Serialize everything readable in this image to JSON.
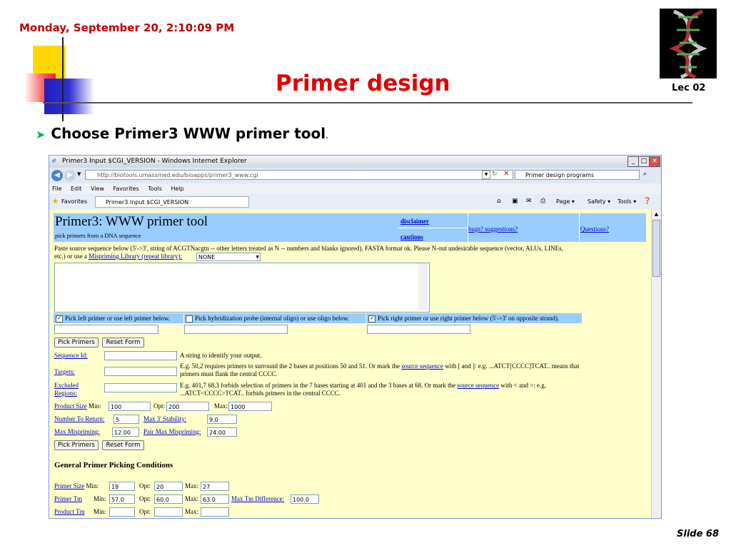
{
  "slide": {
    "datetime": "Monday, September 20, 2:10:09 PM",
    "title": "Primer design",
    "lecture": "Lec 02",
    "bullet": "Choose Primer3 WWW primer tool",
    "bullet_tail": ".",
    "slide_number": "Slide 68"
  },
  "browser": {
    "window_title": "Primer3 Input $CGI_VERSION - Windows Internet Explorer",
    "url": "http://biotools.umassmed.edu/bioapps/primer3_www.cgi",
    "search_value": "Primer design programs",
    "menu": [
      "File",
      "Edit",
      "View",
      "Favorites",
      "Tools",
      "Help"
    ],
    "favorites_label": "Favorites",
    "tab_label": "Primer3 Input $CGI_VERSION",
    "toolbar_right": [
      "Page ▾",
      "Safety ▾",
      "Tools ▾"
    ]
  },
  "page": {
    "heading": "Primer3: WWW primer tool",
    "subheading": "pick primers from a DNA sequence",
    "links": {
      "disclaimer": "disclaimer",
      "cautions": "cautions",
      "bugs": "bugs? suggestions?",
      "questions": "Questions?"
    },
    "intro_text_1": "Paste source sequence below (5'->3', string of ACGTNacgtn -- other letters treated as N -- numbers and blanks ignored). FASTA format ok. Please N-out undesirable sequence (vector, ALUs, LINEs,",
    "intro_text_2_prefix": "etc.) or use a",
    "mispriming_link": "Mispriming Library (repeat library):",
    "mispriming_value": "NONE",
    "pick_left": "Pick left primer or use left primer below.",
    "pick_probe": "Pick hybridization probe (internal oligo) or use oligo below.",
    "pick_right": "Pick right primer or use right primer below (5'->3' on opposite strand).",
    "pick_primers_button": "Pick Primers",
    "reset_form_button": "Reset Form",
    "sequence_id_label": "Sequence Id:",
    "sequence_id_help": "A string to identify your output.",
    "targets_label": "Targets:",
    "targets_help_1_prefix": "E.g. 50,2 requires primers to surround the 2 bases at positions 50 and 51. Or mark the",
    "source_sequence_link": "source sequence",
    "targets_help_1_suffix": "with [ and ]: e.g. ...ATCT[CCCC]TCAT.. means that",
    "targets_help_2": "primers must flank the central CCCC.",
    "excluded_label_1": "Excluded",
    "excluded_label_2": "Regions:",
    "excluded_help_1_prefix": "E.g. 401,7 68,3 forbids selection of primers in the 7 bases starting at 401 and the 3 bases at 68. Or mark the",
    "excluded_help_1_suffix": "with < and >: e.g.",
    "excluded_help_2": "...ATCT<CCCC>TCAT.. forbids primers in the central CCCC.",
    "product_size_label": "Product Size",
    "min_label": "Min:",
    "opt_label": "Opt:",
    "max_label": "Max:",
    "product_size_min": "100",
    "product_size_opt": "200",
    "product_size_max": "1000",
    "number_to_return_label": "Number To Return:",
    "number_to_return": "5",
    "max_stability_label": "Max 3' Stability:",
    "max_stability": "9.0",
    "max_mispriming_label": "Max Mispriming:",
    "max_mispriming": "12.00",
    "pair_max_mispriming_label": "Pair Max Mispriming:",
    "pair_max_mispriming": "24.00",
    "general_heading": "General Primer Picking Conditions",
    "primer_size_label": "Primer Size",
    "primer_size_min": "18",
    "primer_size_opt": "20",
    "primer_size_max": "27",
    "primer_tm_label": "Primer Tm",
    "primer_tm_min": "57.0",
    "primer_tm_opt": "60.0",
    "primer_tm_max": "63.0",
    "max_tm_diff_label": "Max Tm Difference:",
    "max_tm_diff": "100.0",
    "product_tm_label": "Product Tm"
  },
  "colors": {
    "title_red": "#e00000",
    "header_blue": "#99ccff",
    "page_bg": "#ffffcc"
  }
}
